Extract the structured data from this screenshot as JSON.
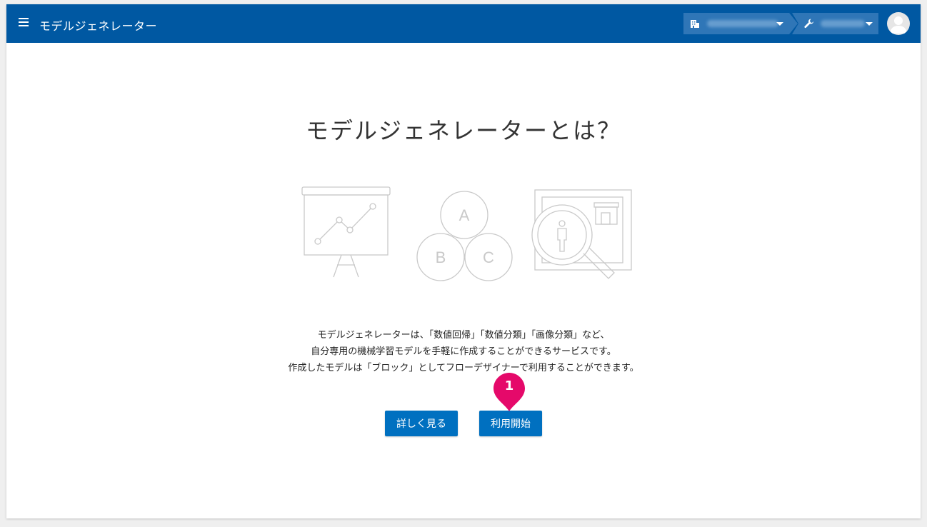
{
  "header": {
    "title": "モデルジェネレーター",
    "org_selector": {
      "label": ""
    },
    "project_selector": {
      "label": ""
    }
  },
  "main": {
    "headline": "モデルジェネレーターとは？",
    "description": [
      "モデルジェネレーターは、「数値回帰」「数値分類」「画像分類」など、",
      "自分専用の機械学習モデルを手軽に作成することができるサービスです。",
      "作成したモデルは「ブロック」としてフローデザイナーで利用することができます。"
    ],
    "illustration_letters": [
      "A",
      "B",
      "C"
    ],
    "buttons": {
      "details": "詳しく見る",
      "start": "利用開始"
    },
    "marker": "1"
  },
  "colors": {
    "header_bg": "#0058a2",
    "selector_bg": "#2f76b7",
    "button_bg": "#0070c0",
    "marker": "#e5096a"
  },
  "icons": [
    "menu-icon",
    "building-icon",
    "wrench-icon",
    "avatar-icon"
  ]
}
